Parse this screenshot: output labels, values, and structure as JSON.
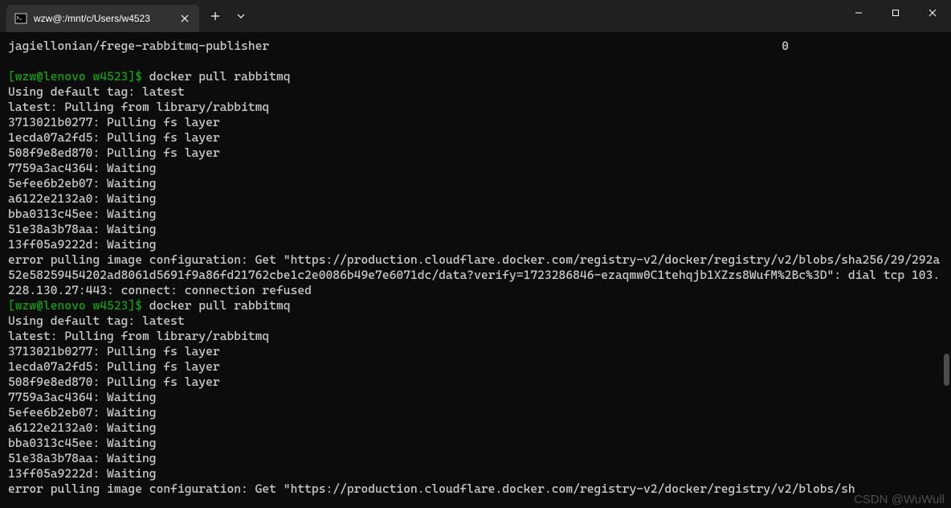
{
  "titlebar": {
    "tab_title": "wzw@:/mnt/c/Users/w4523"
  },
  "terminal": {
    "first_line_left": "jagiellonian/frege-rabbitmq-publisher",
    "first_line_right": "0",
    "prompt1_user": "[wzw@lenovo w4523]$ ",
    "prompt1_cmd": "docker pull rabbitmq",
    "block1_l1": "Using default tag: latest",
    "block1_l2": "latest: Pulling from library/rabbitmq",
    "block1_l3": "3713021b0277: Pulling fs layer",
    "block1_l4": "1ecda07a2fd5: Pulling fs layer",
    "block1_l5": "508f9e8ed870: Pulling fs layer",
    "block1_l6": "7759a3ac4364: Waiting",
    "block1_l7": "5efee6b2eb07: Waiting",
    "block1_l8": "a6122e2132a0: Waiting",
    "block1_l9": "bba0313c45ee: Waiting",
    "block1_l10": "51e38a3b78aa: Waiting",
    "block1_l11": "13ff05a9222d: Waiting",
    "block1_err": "error pulling image configuration: Get \"https://production.cloudflare.docker.com/registry-v2/docker/registry/v2/blobs/sha256/29/292a52e58259454202ad8061d5691f9a86fd21762cbe1c2e0086b49e7e6071dc/data?verify=1723286846-ezaqmw0C1tehqjb1XZzs8WufM%2Bc%3D\": dial tcp 103.228.130.27:443: connect: connection refused",
    "prompt2_user": "[wzw@lenovo w4523]$ ",
    "prompt2_cmd": "docker pull rabbitmq",
    "block2_l1": "Using default tag: latest",
    "block2_l2": "latest: Pulling from library/rabbitmq",
    "block2_l3": "3713021b0277: Pulling fs layer",
    "block2_l4": "1ecda07a2fd5: Pulling fs layer",
    "block2_l5": "508f9e8ed870: Pulling fs layer",
    "block2_l6": "7759a3ac4364: Waiting",
    "block2_l7": "5efee6b2eb07: Waiting",
    "block2_l8": "a6122e2132a0: Waiting",
    "block2_l9": "bba0313c45ee: Waiting",
    "block2_l10": "51e38a3b78aa: Waiting",
    "block2_l11": "13ff05a9222d: Waiting",
    "block2_err": "error pulling image configuration: Get \"https://production.cloudflare.docker.com/registry-v2/docker/registry/v2/blobs/sh"
  },
  "watermark": "CSDN @WuWull"
}
